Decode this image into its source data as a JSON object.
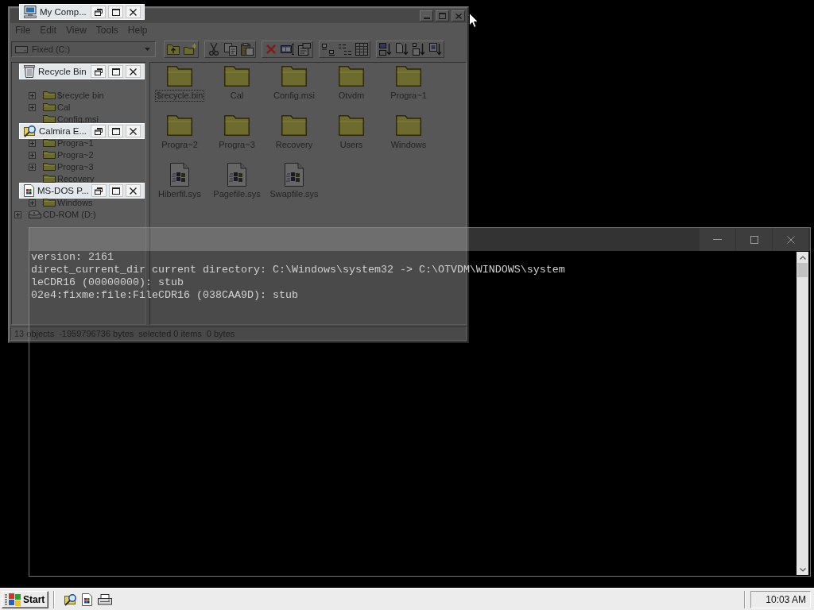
{
  "explorer": {
    "menu": [
      "File",
      "Edit",
      "View",
      "Tools",
      "Help"
    ],
    "drive_box": {
      "value": "Fixed (C:)"
    },
    "tree": [
      {
        "kind": "computer",
        "children": [
          {
            "kind": "drive",
            "children": [
              {
                "label": "$recycle bin",
                "kind": "folder",
                "expandable": true
              },
              {
                "label": "Cal",
                "kind": "folder",
                "expandable": true
              },
              {
                "label": "Config.msi",
                "kind": "folder",
                "expandable": false
              },
              {
                "kind": "folder"
              },
              {
                "label": "Progra~1",
                "kind": "folder",
                "expandable": true
              },
              {
                "label": "Progra~2",
                "kind": "folder",
                "expandable": true
              },
              {
                "label": "Progra~3",
                "kind": "folder",
                "expandable": true
              },
              {
                "label": "Recovery",
                "kind": "folder",
                "expandable": false
              },
              {
                "kind": "folder"
              },
              {
                "label": "Windows",
                "kind": "folder",
                "expandable": true
              }
            ]
          },
          {
            "label": "CD-ROM (D:)",
            "kind": "cdrom",
            "expandable": true
          }
        ]
      }
    ],
    "files": [
      {
        "label": "$recycle.bin",
        "kind": "folder",
        "focused": true
      },
      {
        "label": "Cal",
        "kind": "folder",
        "focused": false
      },
      {
        "label": "Config.msi",
        "kind": "folder",
        "focused": false
      },
      {
        "label": "Otvdm",
        "kind": "folder",
        "focused": false
      },
      {
        "label": "Progra~1",
        "kind": "folder",
        "focused": false
      },
      {
        "label": "Progra~2",
        "kind": "folder",
        "focused": false
      },
      {
        "label": "Progra~3",
        "kind": "folder",
        "focused": false
      },
      {
        "label": "Recovery",
        "kind": "folder",
        "focused": false
      },
      {
        "label": "Users",
        "kind": "folder",
        "focused": false
      },
      {
        "label": "Windows",
        "kind": "folder",
        "focused": false
      },
      {
        "label": "Hiberfil.sys",
        "kind": "system",
        "focused": false
      },
      {
        "label": "Pagefile.sys",
        "kind": "system",
        "focused": false
      },
      {
        "label": "Swapfile.sys",
        "kind": "system",
        "focused": false
      }
    ],
    "status": [
      "13 objects",
      "-1959796736 bytes",
      "selected 0 items",
      "0 bytes"
    ]
  },
  "console": {
    "lines": [
      "version: 2161",
      "direct_current_dir current directory: C:\\Windows\\system32 -> C:\\OTVDM\\WINDOWS\\system",
      "leCDR16 (00000000): stub",
      "02e4:fixme:file:FileCDR16 (038CAA9D): stub"
    ]
  },
  "minimized_windows": [
    {
      "title": "My Comp...",
      "kind": "computer"
    },
    {
      "title": "Recycle Bin",
      "kind": "recycle-bin"
    },
    {
      "title": "Calmira E...",
      "kind": "explorer"
    },
    {
      "title": "MS-DOS P...",
      "kind": "dos"
    }
  ],
  "taskbar": {
    "start": "Start",
    "clock": "10:03 AM"
  }
}
